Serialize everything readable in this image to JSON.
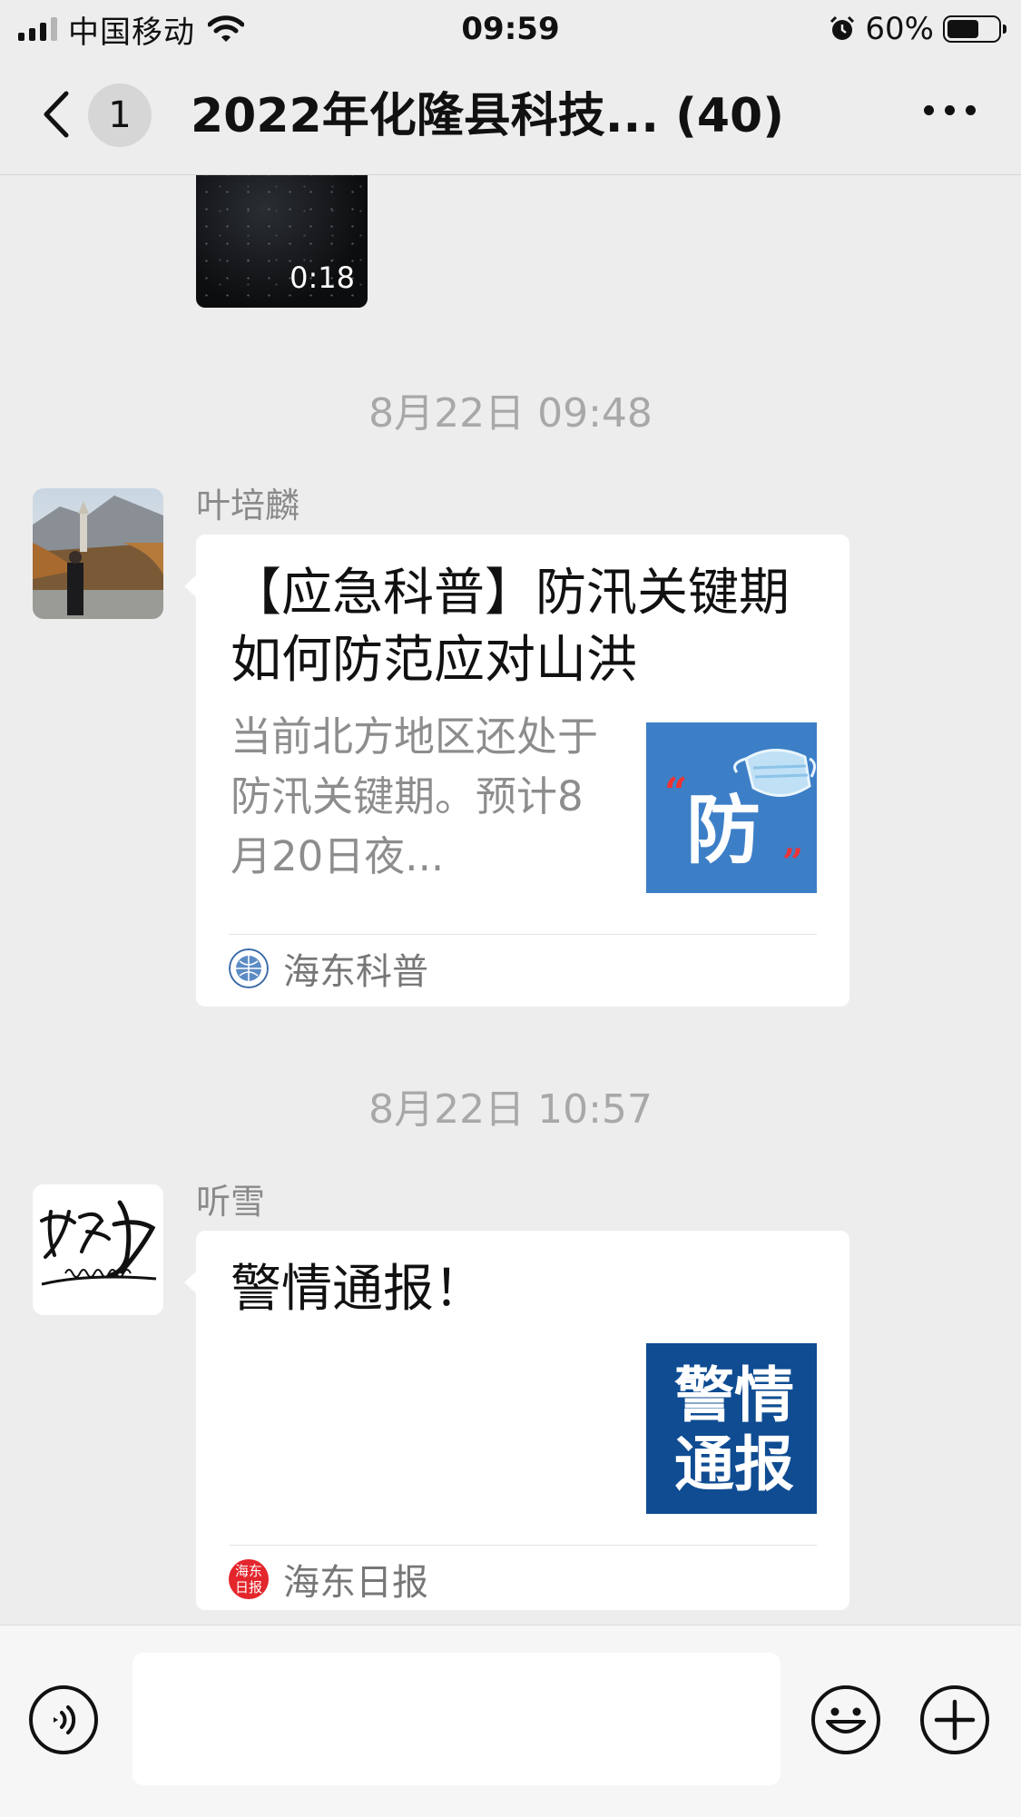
{
  "status_bar": {
    "carrier": "中国移动",
    "time": "09:59",
    "battery_percent": "60%",
    "battery_level": 0.6,
    "icons": [
      "signal-icon",
      "wifi-icon",
      "alarm-icon",
      "battery-icon"
    ]
  },
  "nav": {
    "back_icon": "chevron-left-icon",
    "unread_count": "1",
    "title": "2022年化隆县科技... (40)",
    "more_icon": "more-dots-icon"
  },
  "messages": {
    "video": {
      "duration": "0:18"
    },
    "timestamp_1": "8月22日 09:48",
    "msg_1": {
      "sender": "叶培麟",
      "title": "【应急科普】防汛关键期如何防范应对山洪",
      "description": "当前北方地区还处于防汛关键期。预计8月20日夜...",
      "thumb_text": "防",
      "source": "海东科普"
    },
    "timestamp_2": "8月22日 10:57",
    "msg_2": {
      "sender": "听雪",
      "avatar_text": "努力",
      "title": "警情通报！",
      "thumb_line1": "警情",
      "thumb_line2": "通报",
      "source": "海东日报",
      "source_logo_text": "海东日报"
    }
  },
  "input_bar": {
    "voice_icon": "voice-icon",
    "emoji_icon": "emoji-icon",
    "plus_icon": "plus-icon",
    "input_value": ""
  },
  "colors": {
    "background": "#ededed",
    "bubble": "#ffffff",
    "thumb_blue": "#3d7fc7",
    "thumb_navy": "#0f4c92",
    "timestamp": "#a8a8a8"
  }
}
